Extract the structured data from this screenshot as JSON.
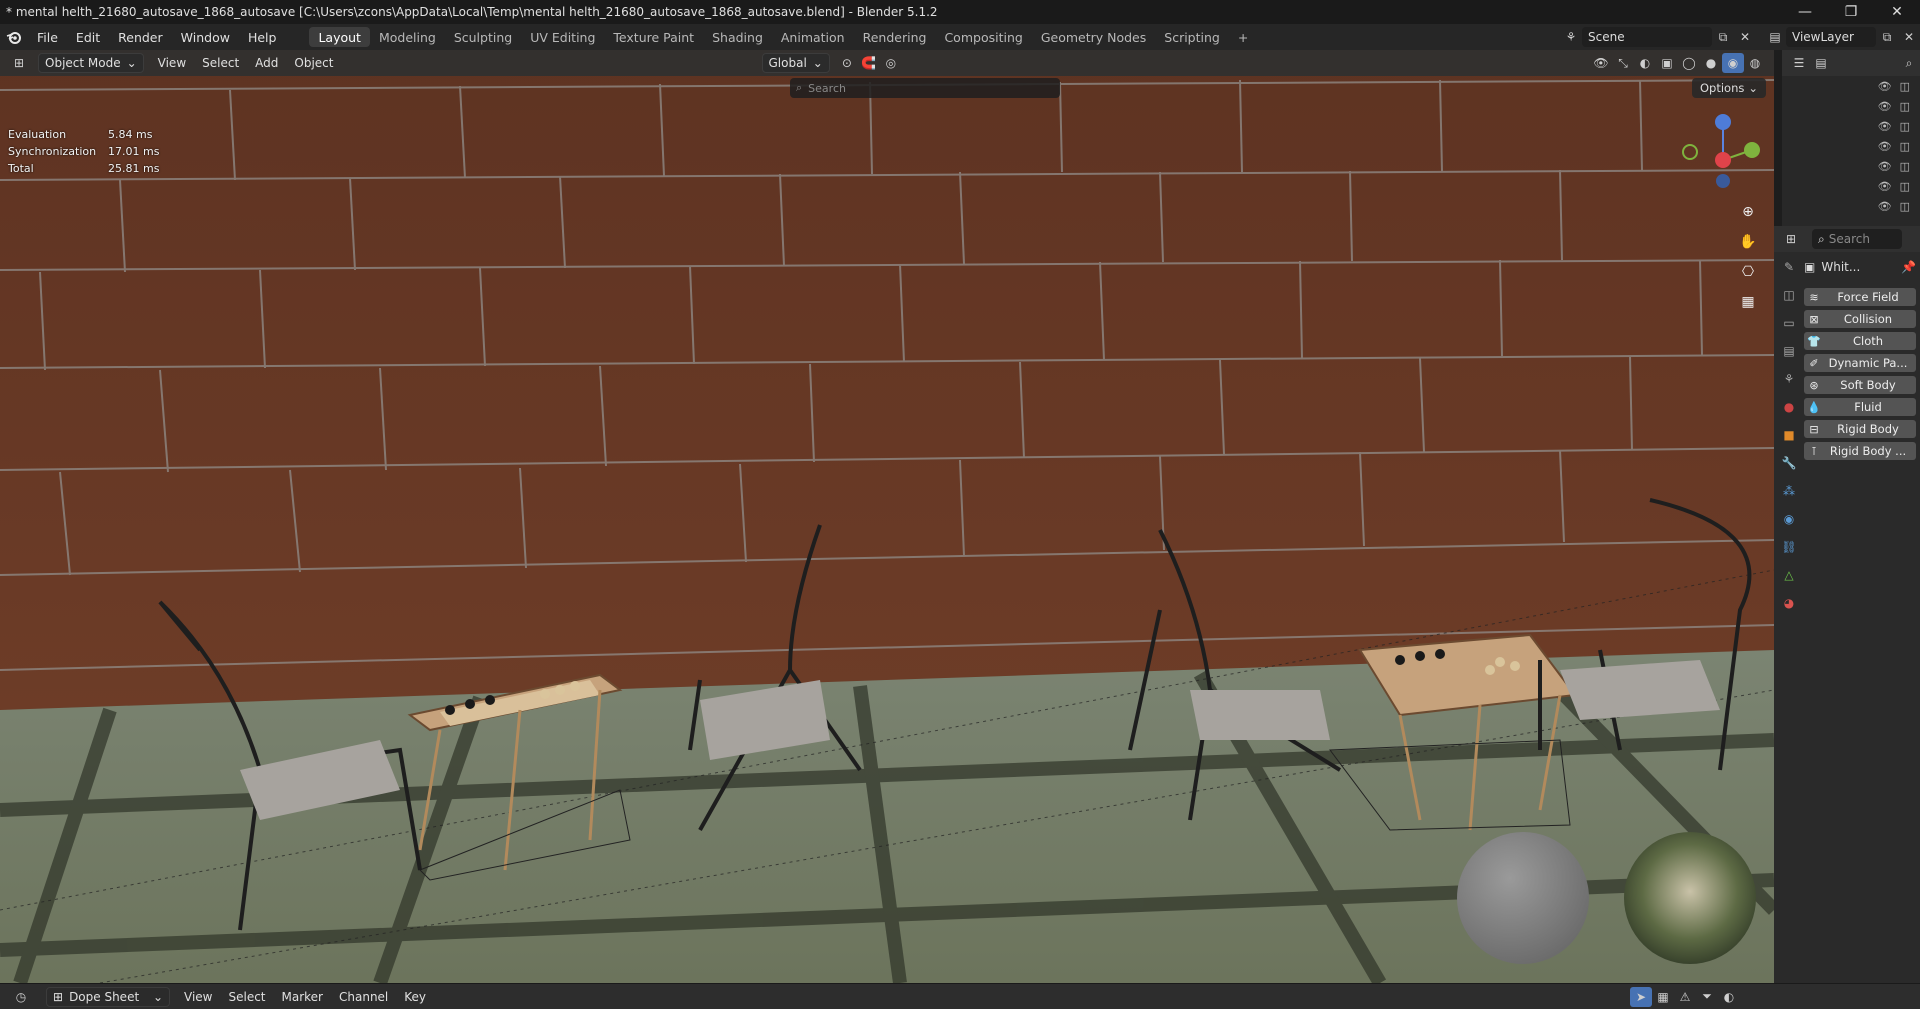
{
  "window": {
    "title": "* mental helth_21680_autosave_1868_autosave [C:\\Users\\zcons\\AppData\\Local\\Temp\\mental helth_21680_autosave_1868_autosave.blend] - Blender 5.1.2",
    "controls": [
      "—",
      "❐",
      "✕"
    ]
  },
  "menu": {
    "items": [
      "File",
      "Edit",
      "Render",
      "Window",
      "Help"
    ]
  },
  "workspaces": {
    "tabs": [
      "Layout",
      "Modeling",
      "Sculpting",
      "UV Editing",
      "Texture Paint",
      "Shading",
      "Animation",
      "Rendering",
      "Compositing",
      "Geometry Nodes",
      "Scripting"
    ],
    "add": "+"
  },
  "scene": {
    "name": "Scene",
    "view_layer": "ViewLayer"
  },
  "viewport": {
    "mode": "Object Mode",
    "menus": [
      "View",
      "Select",
      "Add",
      "Object"
    ],
    "orientation": "Global",
    "search_placeholder": "Search",
    "options_label": "Options",
    "stats": [
      {
        "label": "Evaluation",
        "value": "5.84 ms"
      },
      {
        "label": "Synchronization",
        "value": "17.01 ms"
      },
      {
        "label": "Total",
        "value": "25.81 ms"
      }
    ],
    "gizmo": {
      "z": "Z",
      "y": "Y",
      "x": "X"
    }
  },
  "outliner": {
    "search_placeholder": "Search"
  },
  "properties": {
    "search_placeholder": "Search",
    "object_name": "Whit...",
    "physics_buttons": [
      {
        "label": "Force Field",
        "icon": "force-field-icon"
      },
      {
        "label": "Collision",
        "icon": "collision-icon"
      },
      {
        "label": "Cloth",
        "icon": "cloth-icon"
      },
      {
        "label": "Dynamic Pa...",
        "icon": "dynamic-paint-icon"
      },
      {
        "label": "Soft Body",
        "icon": "soft-body-icon"
      },
      {
        "label": "Fluid",
        "icon": "fluid-icon"
      },
      {
        "label": "Rigid Body",
        "icon": "rigid-body-icon"
      },
      {
        "label": "Rigid Body ...",
        "icon": "rigid-body-constraint-icon"
      }
    ]
  },
  "timeline": {
    "editor": "Dope Sheet",
    "menus": [
      "View",
      "Select",
      "Marker",
      "Channel",
      "Key"
    ]
  },
  "colors": {
    "wall": "#6b3a26",
    "floor": "#6f7560",
    "accent": "#4772b3"
  }
}
